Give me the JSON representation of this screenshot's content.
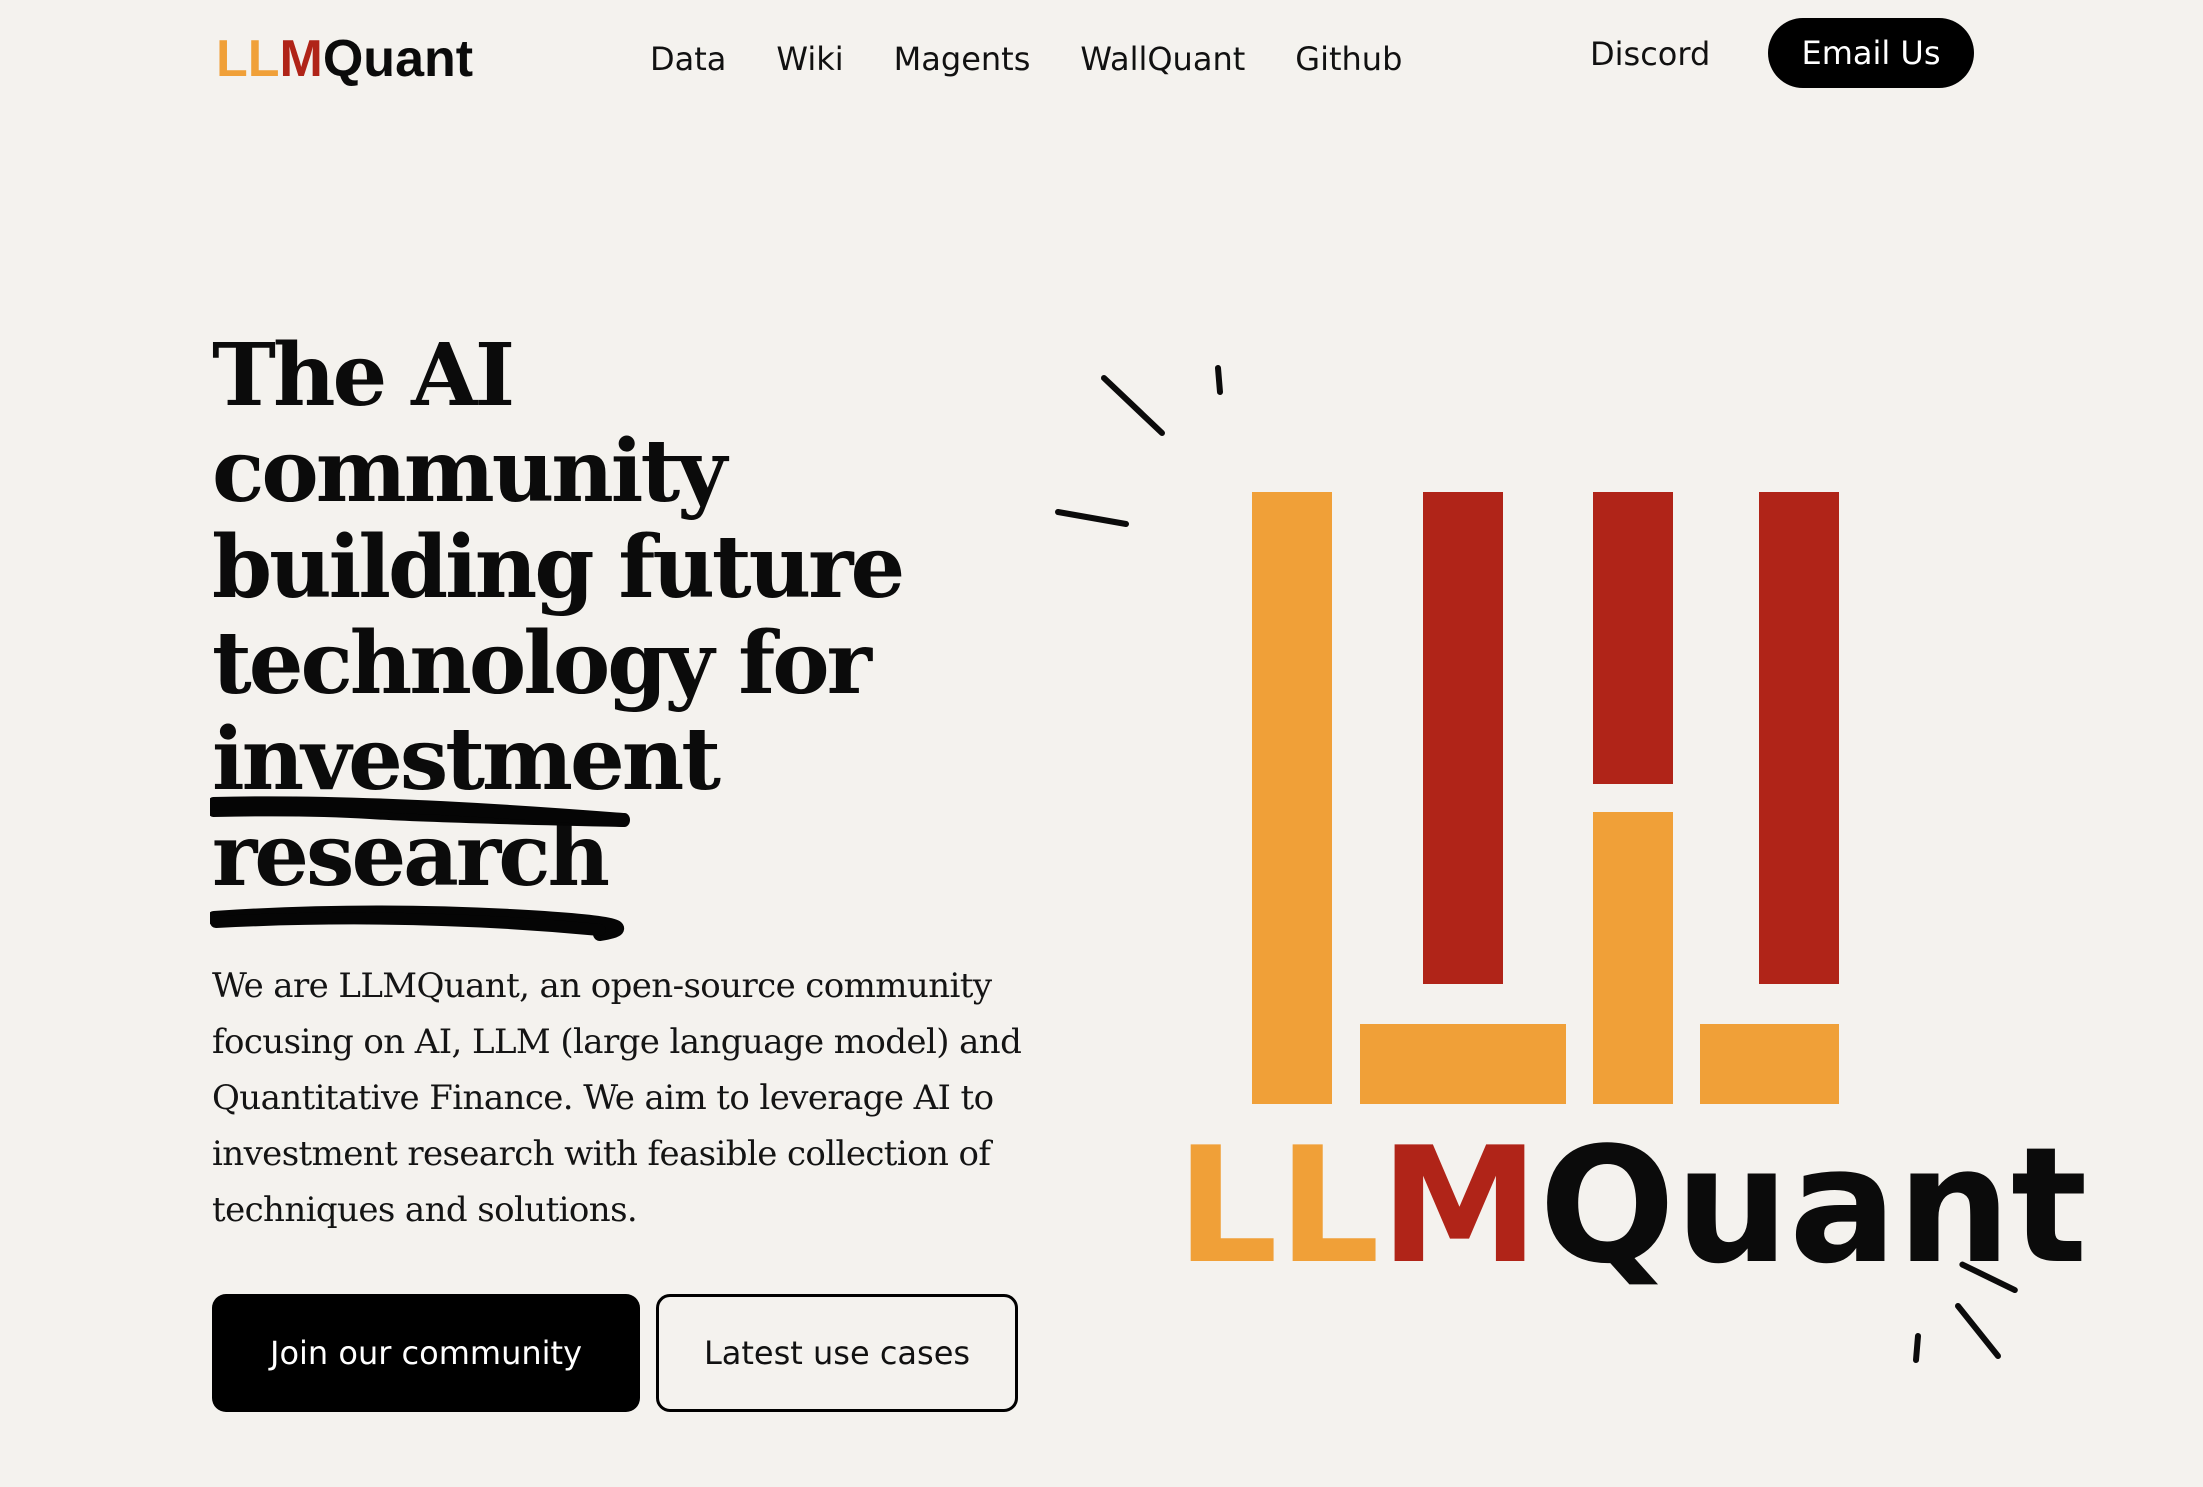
{
  "brand": {
    "parts": [
      "LL",
      "M",
      "Quant"
    ],
    "colors": [
      "#f0a038",
      "#b02418",
      "#0b0b0b"
    ]
  },
  "nav": {
    "links": [
      "Data",
      "Wiki",
      "Magents",
      "WallQuant",
      "Github"
    ],
    "discord": "Discord",
    "email_button": "Email Us"
  },
  "hero": {
    "heading_lines": [
      "The AI",
      "community",
      "building future",
      "technology for",
      "investment",
      "research"
    ],
    "body_lines": [
      "We are LLMQuant, an open-source community",
      "focusing on AI, LLM (large language model) and",
      "Quantitative Finance. We aim to leverage AI to",
      "investment research with feasible collection of",
      "techniques and solutions."
    ],
    "primary_button": "Join our community",
    "secondary_button": "Latest use cases"
  },
  "logo": {
    "wordmark_parts": [
      "LL",
      "M",
      "Quant"
    ],
    "colors": {
      "orange": "#f0a038",
      "red": "#b02418",
      "black": "#0b0b0b"
    }
  }
}
